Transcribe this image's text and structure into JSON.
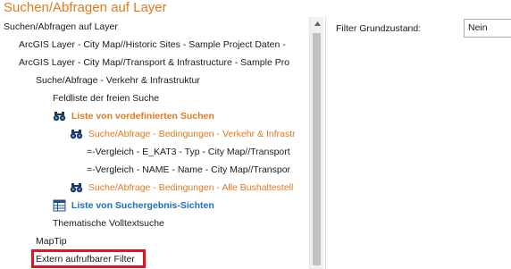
{
  "title": "Suchen/Abfragen auf Layer",
  "tree": {
    "items": [
      {
        "label": "Suchen/Abfragen auf Layer"
      },
      {
        "label": "ArcGIS Layer - City Map//Historic Sites - Sample Project Daten -"
      },
      {
        "label": "ArcGIS Layer - City Map//Transport & Infrastructure - Sample Pro"
      },
      {
        "label": "Suche/Abfrage - Verkehr & Infrastruktur"
      },
      {
        "label": "Feldliste der freien Suche"
      },
      {
        "label": "Liste von vordefinierten Suchen",
        "icon": "binoculars-icon"
      },
      {
        "label": "Suche/Abfrage - Bedingungen - Verkehr & Infrastr",
        "icon": "binoculars-icon"
      },
      {
        "label": "=-Vergleich - E_KAT3 - Typ - City Map//Transport"
      },
      {
        "label": "=-Vergleich - NAME - Name - City Map//Transpor"
      },
      {
        "label": "Suche/Abfrage - Bedingungen - Alle Bushaltestell",
        "icon": "binoculars-icon"
      },
      {
        "label": "Liste von Suchergebnis-Sichten",
        "icon": "table-view-icon"
      },
      {
        "label": "Thematische Volltextsuche"
      },
      {
        "label": "MapTip"
      },
      {
        "label": "Extern aufrufbarer Filter"
      }
    ]
  },
  "properties": {
    "filter_label": "Filter Grundzustand:",
    "filter_value": "Nein"
  },
  "colors": {
    "accent_orange": "#e07a1f",
    "accent_blue": "#1f6fbf",
    "highlight_red": "#e3141e"
  }
}
